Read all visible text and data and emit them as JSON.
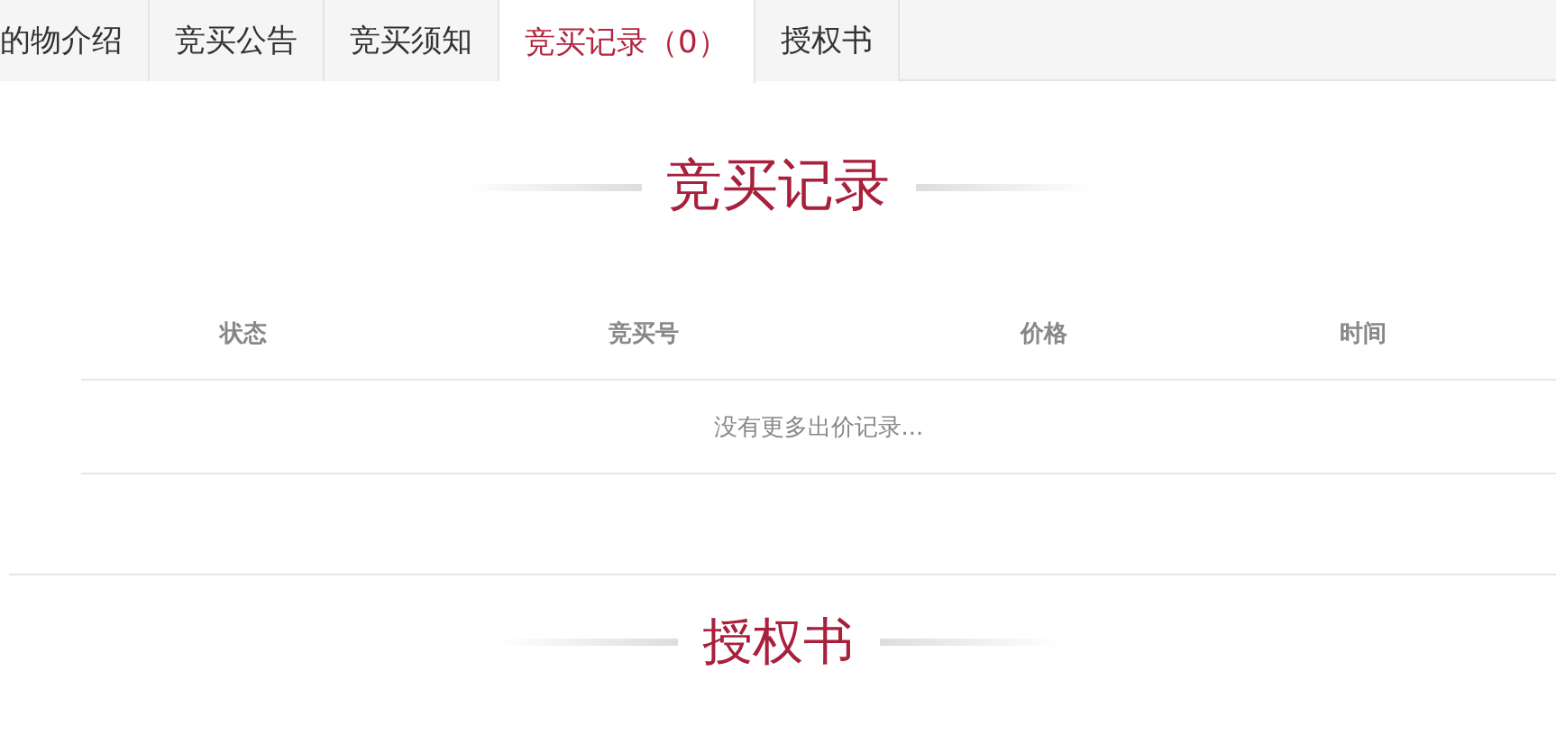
{
  "tabs": [
    {
      "label": "的物介绍",
      "selected": false
    },
    {
      "label": "竞买公告",
      "selected": false
    },
    {
      "label": "竞买须知",
      "selected": false
    },
    {
      "label": "竞买记录（0）",
      "selected": true
    },
    {
      "label": "授权书",
      "selected": false
    }
  ],
  "records": {
    "title": "竞买记录",
    "columns": [
      "状态",
      "竞买号",
      "价格",
      "时间"
    ],
    "empty_message": "没有更多出价记录..."
  },
  "next_section": {
    "title": "授权书"
  }
}
